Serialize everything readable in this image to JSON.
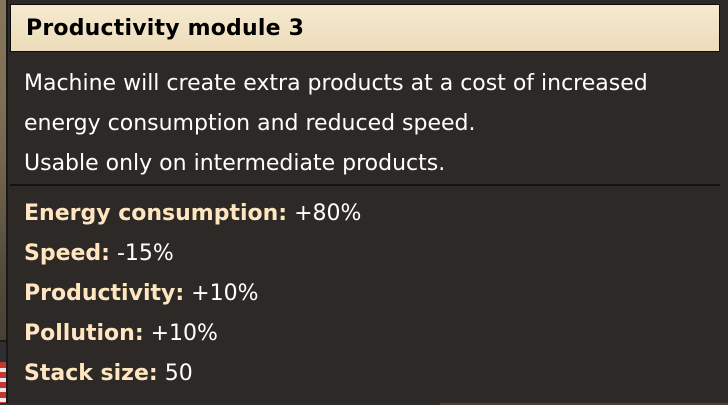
{
  "tooltip": {
    "title": "Productivity module 3",
    "description": [
      "Machine will create extra products at a cost of increased",
      "energy consumption and reduced speed.",
      "Usable only on intermediate products."
    ],
    "stats": [
      {
        "label": "Energy consumption:",
        "value": "+80%"
      },
      {
        "label": "Speed:",
        "value": "-15%"
      },
      {
        "label": "Productivity:",
        "value": "+10%"
      },
      {
        "label": "Pollution:",
        "value": "+10%"
      },
      {
        "label": "Stack size:",
        "value": "50"
      }
    ]
  },
  "colors": {
    "header_bg": "#f2e4c4",
    "panel_bg": "#2c2926",
    "stat_label": "#ffe6c0"
  }
}
